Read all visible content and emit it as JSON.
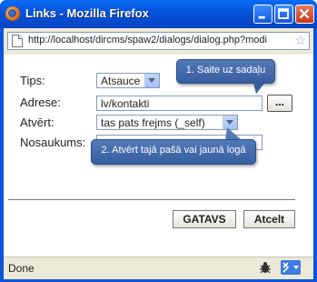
{
  "window": {
    "title": "Links - Mozilla Firefox",
    "url": "http://localhost/dircms/spaw2/dialogs/dialog.php?modi"
  },
  "form": {
    "type_label": "Tips:",
    "type_value": "Atsauce",
    "address_label": "Adrese:",
    "address_value": "lv/kontakti",
    "browse_label": "...",
    "open_label": "Atvērt:",
    "open_value": "tas pats frejms (_self)",
    "name_label": "Nosaukums:",
    "name_value": ""
  },
  "callouts": {
    "one": "1. Saite uz sadaļu",
    "two": "2. Atvērt tajā pašā vai jaunā logā"
  },
  "buttons": {
    "ok": "GATAVS",
    "cancel": "Atcelt"
  },
  "status": {
    "text": "Done"
  }
}
